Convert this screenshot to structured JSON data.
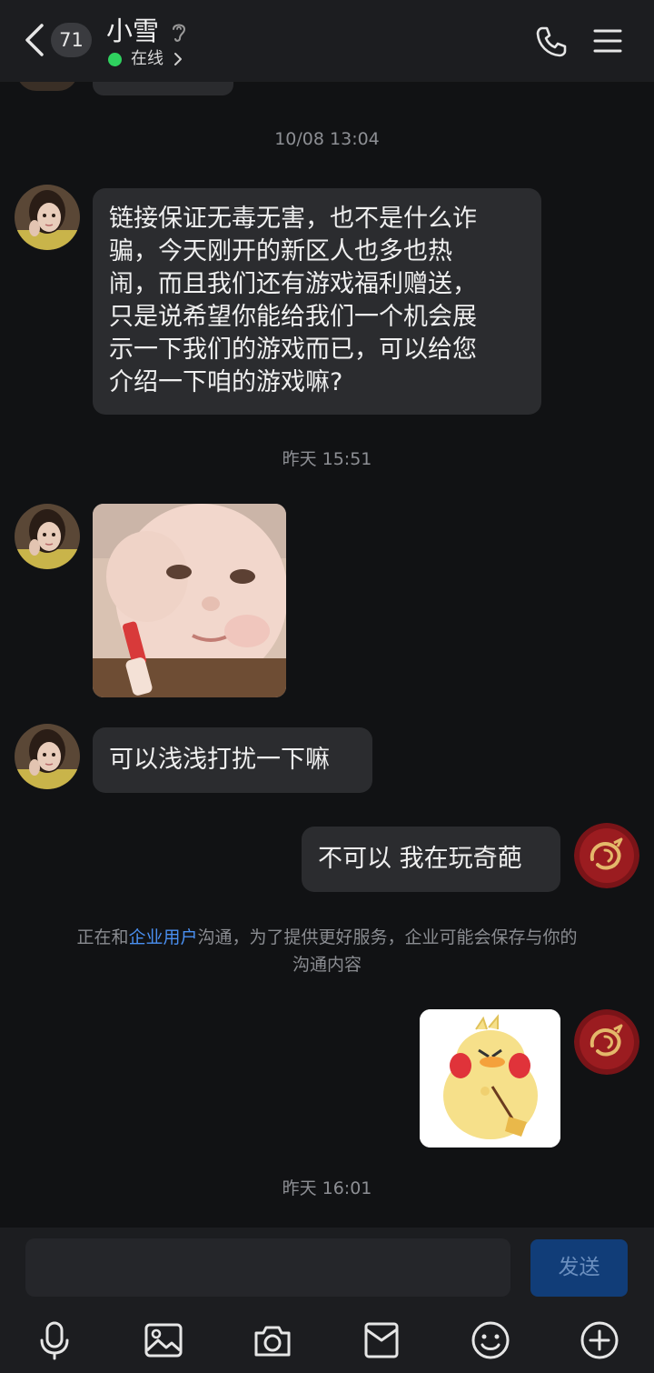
{
  "header": {
    "unread_count": "71",
    "contact_name": "小雪",
    "status": "在线",
    "icons": [
      "back-arrow-icon",
      "hearing-icon",
      "chevron-right-icon",
      "phone-icon",
      "menu-icon"
    ]
  },
  "messages": [
    {
      "type": "timestamp",
      "text": "10/08 13:04"
    },
    {
      "type": "text",
      "from": "contact",
      "lines": [
        "链接保证无毒无害，也不是什么诈",
        "骗，今天刚开的新区人也多也热",
        "闹，而且我们还有游戏福利赠送，",
        "只是说希望你能给我们一个机会展",
        "示一下我们的游戏而已，可以给您",
        "介绍一下咱的游戏嘛?"
      ]
    },
    {
      "type": "timestamp",
      "text": "昨天 15:51"
    },
    {
      "type": "image",
      "from": "contact",
      "content": "baby sticker holding lipstick"
    },
    {
      "type": "text",
      "from": "contact",
      "lines": [
        "可以浅浅打扰一下嘛"
      ]
    },
    {
      "type": "text",
      "from": "me",
      "lines": [
        "不可以 我在玩奇葩"
      ]
    },
    {
      "type": "notice",
      "prefix": "正在和",
      "link": "企业用户",
      "suffix_line1": "沟通，为了提供更好服务，企业可能会保存与你的",
      "line2": "沟通内容"
    },
    {
      "type": "image",
      "from": "me",
      "content": "duck sticker"
    },
    {
      "type": "timestamp",
      "text": "昨天 16:01"
    }
  ],
  "composer": {
    "input_value": "",
    "send_label": "发送",
    "tools": [
      "microphone-icon",
      "image-icon",
      "camera-icon",
      "envelope-icon",
      "emoji-icon",
      "plus-icon"
    ]
  },
  "colors": {
    "background": "#111214",
    "bar": "#1c1d20",
    "bubble": "#2b2c2f",
    "online": "#2fd15f",
    "link": "#4a8ff0",
    "send_button": "#113d78"
  }
}
